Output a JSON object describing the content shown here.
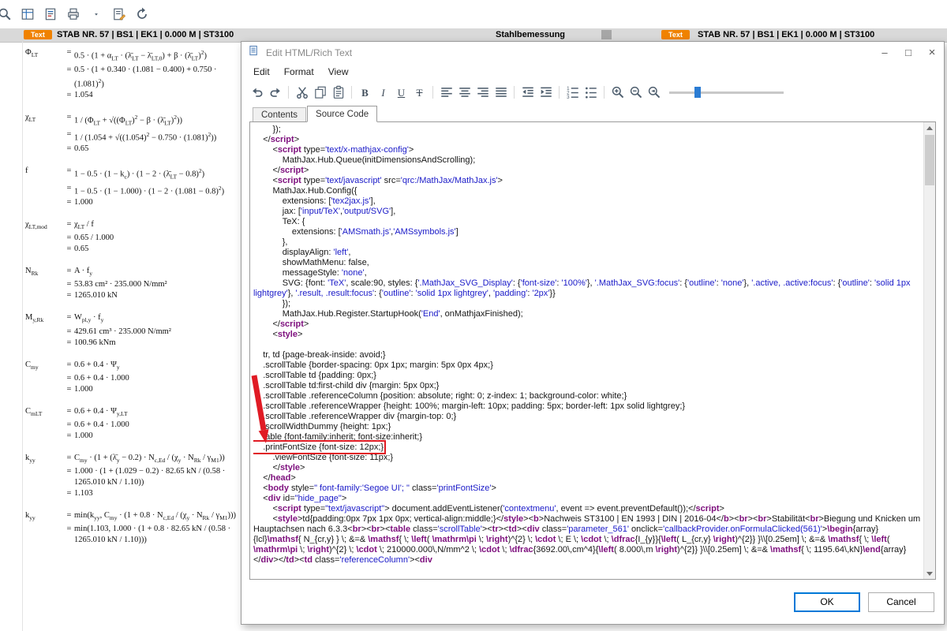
{
  "colors": {
    "accent_orange": "#f08200",
    "accent_blue": "#0078d7",
    "header_gray": "#d9d9d9",
    "syntax_tag": "#7d0f7d",
    "syntax_string": "#1a1ac8",
    "annotation_red": "#e01b24"
  },
  "top_toolbar": {
    "icons": [
      "zoom-icon",
      "table-view-icon",
      "form-view-icon",
      "print-view-icon",
      "dropdown-arrow-icon",
      "rich-text-edit-icon",
      "refresh-icon"
    ]
  },
  "header": {
    "left_badge": "Text",
    "left_title": "STAB NR. 57 | BS1 | EK1 | 0.000 M | ST3100",
    "center_title": "Stahlbemessung",
    "right_badge": "Text",
    "right_title": "STAB NR. 57 | BS1 | EK1 | 0.000 M | ST3100"
  },
  "formulas": {
    "blocks": [
      {
        "lhs": "Φ_{LT}",
        "rows": [
          "0.5 · (1 + α_{LT} · (λ̄_{LT} − λ̄_{LT,0}) + β · (λ̄_{LT})^{2})",
          "0.5 · (1 + 0.340 · (1.081 − 0.400) + 0.750 · (1.081)^{2})",
          "1.054"
        ]
      },
      {
        "lhs": "χ_{LT}",
        "rows": [
          "1 / (Φ_{LT} + √((Φ_{LT})^{2} − β · (λ̄_{LT})^{2}))",
          "1 / (1.054 + √((1.054)^{2} − 0.750 · (1.081)^{2}))",
          "0.65"
        ]
      },
      {
        "lhs": "f",
        "rows": [
          "1 − 0.5 · (1 − k_{c}) · (1 − 2 · (λ̄_{LT} − 0.8)^{2})",
          "1 − 0.5 · (1 − 1.000) · (1 − 2 · (1.081 − 0.8)^{2})",
          "1.000"
        ]
      },
      {
        "lhs": "χ_{LT,mod}",
        "rows": [
          "χ_{LT} / f",
          "0.65 / 1.000",
          "0.65"
        ]
      },
      {
        "lhs": "N_{Rk}",
        "rows": [
          "A · f_{y}",
          "53.83 cm² · 235.000 N/mm²",
          "1265.010 kN"
        ]
      },
      {
        "lhs": "M_{y,Rk}",
        "rows": [
          "W_{pl,y} · f_{y}",
          "429.61 cm³ · 235.000 N/mm²",
          "100.96 kNm"
        ]
      },
      {
        "lhs": "C_{my}",
        "rows": [
          "0.6 + 0.4 · Ψ_{y}",
          "0.6 + 0.4 · 1.000",
          "1.000"
        ]
      },
      {
        "lhs": "C_{mLT}",
        "rows": [
          "0.6 + 0.4 · Ψ_{y,LT}",
          "0.6 + 0.4 · 1.000",
          "1.000"
        ]
      },
      {
        "lhs": "k_{yy}",
        "rows": [
          "C_{my} · (1 + (λ̄_{y} − 0.2) · N_{c,Ed} / (χ_{y} · N_{Rk} / γ_{M1}))",
          "1.000 · (1 + (1.029 − 0.2) · 82.65 kN / (0.58 · 1265.010 kN / 1.10))",
          "1.103"
        ]
      },
      {
        "lhs": "k_{yy}",
        "rows": [
          "min(k_{yy}, C_{my} · (1 + 0.8 · N_{c,Ed} / (χ_{y} · N_{Rk} / γ_{M1})))",
          "min(1.103, 1.000 · (1 + 0.8 · 82.65 kN / (0.58 · 1265.010 kN / 1.10)))"
        ]
      }
    ]
  },
  "dialog": {
    "title": "Edit HTML/Rich Text",
    "window_controls": [
      "minimize-icon",
      "maximize-icon",
      "close-icon"
    ],
    "menu": [
      "Edit",
      "Format",
      "View"
    ],
    "toolbar_groups": [
      [
        "undo-icon",
        "redo-icon"
      ],
      [
        "cut-icon",
        "copy-icon",
        "paste-icon"
      ],
      [
        "bold-icon",
        "italic-icon",
        "underline-icon",
        "strikethrough-icon"
      ],
      [
        "align-left-icon",
        "align-center-icon",
        "align-right-icon",
        "align-justify-icon"
      ],
      [
        "indent-decrease-icon",
        "indent-increase-icon"
      ],
      [
        "numbered-list-icon",
        "bullet-list-icon"
      ],
      [
        "zoom-in-icon",
        "zoom-out-icon",
        "zoom-reset-icon"
      ]
    ],
    "slider": {
      "value_pct": 22
    },
    "tabs": [
      {
        "label": "Contents",
        "active": false
      },
      {
        "label": "Source Code",
        "active": true
      }
    ],
    "code": {
      "highlight_index": 30,
      "lines": [
        "        });",
        "    </script>",
        "        <script type='text/x-mathjax-config'>",
        "            MathJax.Hub.Queue(initDimensionsAndScrolling);",
        "        </script>",
        "        <script type='text/javascript' src='qrc:/MathJax/MathJax.js'>",
        "        MathJax.Hub.Config({",
        "            extensions: ['tex2jax.js'],",
        "            jax: ['input/TeX','output/SVG'],",
        "            TeX: {",
        "                extensions: ['AMSmath.js','AMSsymbols.js']",
        "            },",
        "            displayAlign: 'left',",
        "            showMathMenu: false,",
        "            messageStyle: 'none',",
        "            SVG: {font: 'TeX', scale:90, styles: {'.MathJax_SVG_Display': {'font-size': '100%'}, '.MathJax_SVG:focus': {'outline': 'none'}, '.active, .active:focus': {'outline': 'solid 1px lightgrey'}, '.result, .result:focus': {'outline': 'solid 1px lightgrey', 'padding': '2px'}}",
        "            });",
        "            MathJax.Hub.Register.StartupHook('End', onMathjaxFinished);",
        "        </script>",
        "        <style>",
        "",
        "    tr, td {page-break-inside: avoid;}",
        "    .scrollTable {border-spacing: 0px 1px; margin: 5px 0px 4px;}",
        "    .scrollTable td {padding: 0px;}",
        "    .scrollTable td:first-child div {margin: 5px 0px;}",
        "    .scrollTable .referenceColumn {position: absolute; right: 0; z-index: 1; background-color: white;}",
        "    .scrollTable .referenceWrapper {height: 100%; margin-left: 10px; padding: 5px; border-left: 1px solid lightgrey;}",
        "    .scrollTable .referenceWrapper div {margin-top: 0;}",
        "    .scrollWidthDummy {height: 1px;}",
        "    table {font-family:inherit; font-size:inherit;}",
        "    .printFontSize {font-size: 12px;}",
        "        .viewFontSize {font-size: 11px;}",
        "        </style>",
        "    </head>",
        "    <body style=\" font-family:'Segoe UI'; \" class='printFontSize'>",
        "    <div id=\"hide_page\">",
        "        <script type=\"text/javascript\"> document.addEventListener('contextmenu', event => event.preventDefault());</script>",
        "        <style>td{padding:0px 7px 1px 0px; vertical-align:middle;}</style><b>Nachweis ST3100 | EN 1993 | DIN | 2016-04</b><br><br>Stabilität<br>Biegung und Knicken um Hauptachsen nach 6.3.3<br><br><table class='scrollTable'><tr><td><div class='parameter_561' onclick='callbackProvider.onFormulaClicked(561)'>\\begin{array}{lcl}\\mathsf{ N_{cr,y} } \\; &=& \\mathsf{ \\; \\left( \\mathrm\\pi \\; \\right)^{2} \\; \\cdot \\; E \\; \\cdot \\; \\dfrac{I_{y}}{\\left( L_{cr,y} \\right)^{2}} }\\\\[0.25em] \\; &=& \\mathsf{ \\; \\left( \\mathrm\\pi \\; \\right)^{2} \\; \\cdot \\; 210000.000\\,N/mm^2 \\; \\cdot \\; \\dfrac{3692.00\\,cm^4}{\\left( 8.000\\,m \\right)^{2}} }\\\\[0.25em] \\; &=& \\mathsf{ \\; 1195.64\\,kN}\\end{array}</div></td><td class='referenceColumn'><div"
      ]
    },
    "ok_label": "OK",
    "cancel_label": "Cancel"
  }
}
